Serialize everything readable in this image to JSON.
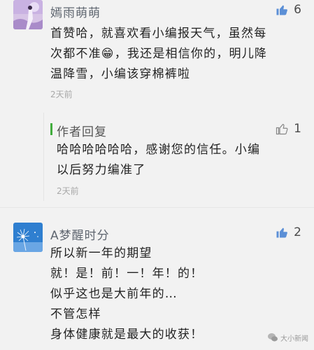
{
  "comments": [
    {
      "username": "嫣雨萌萌",
      "likes": "6",
      "lines": [
        "首赞哈，就喜欢看小编报天气，虽然每",
        "次都不准😁，我还是相信你的，明儿降",
        "温降雪，小编该穿棉裤啦"
      ],
      "time": "2天前",
      "reply": {
        "label": "作者回复",
        "likes": "1",
        "lines": [
          "哈哈哈哈哈哈，感谢您的信任。小编",
          "以后努力编准了"
        ],
        "time": "2天前"
      }
    },
    {
      "username": "A梦醒时分",
      "likes": "2",
      "lines": [
        "所以新一年的期望",
        "就！是！前！一！年！的！",
        "似乎这也是大前年的…",
        "不管怎样",
        "身体健康就是最大的收获！"
      ]
    }
  ],
  "watermark": "大小新闻",
  "colors": {
    "accent_green": "#42ad3e",
    "like_icon": "#5b8fd6"
  }
}
